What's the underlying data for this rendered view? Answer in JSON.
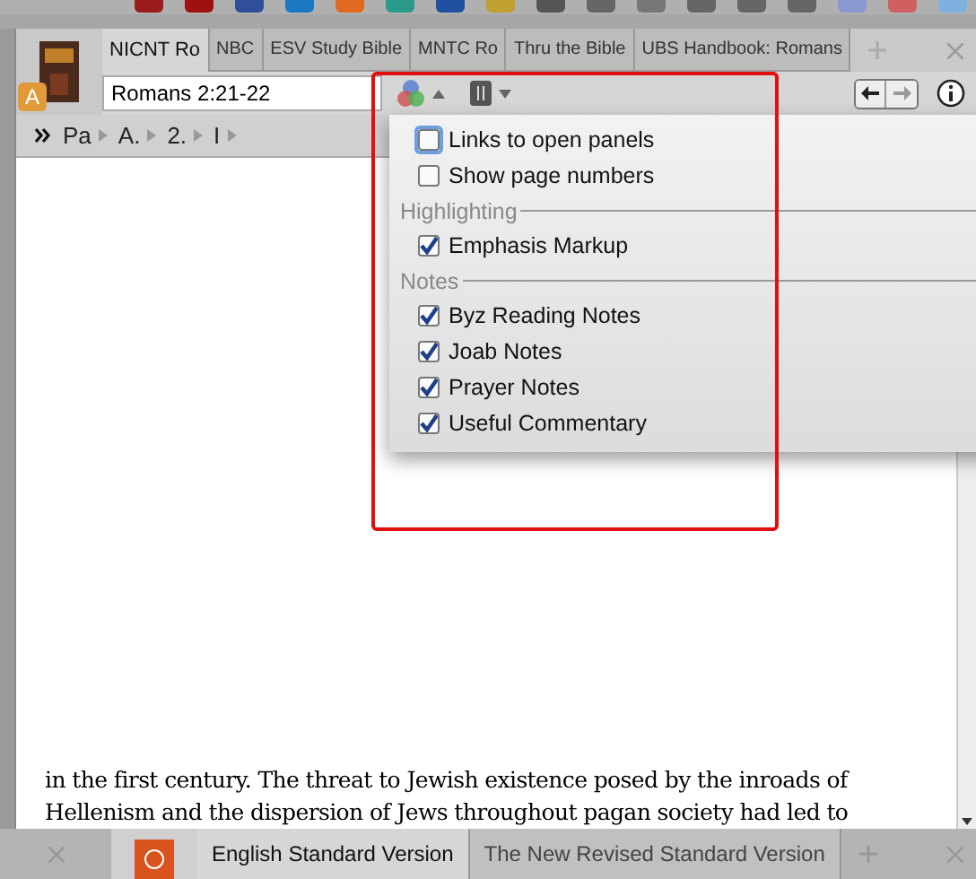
{
  "dock": [
    {
      "color": "#9b1c1c"
    },
    {
      "color": "#a01010"
    },
    {
      "color": "#2f4f9a"
    },
    {
      "color": "#1a78c2"
    },
    {
      "color": "#e06a20"
    },
    {
      "color": "#2a9a8a"
    },
    {
      "color": "#2050a0"
    },
    {
      "color": "#c0a030"
    },
    {
      "color": "#555555"
    },
    {
      "color": "#666666"
    },
    {
      "color": "#777777"
    },
    {
      "color": "#666666"
    },
    {
      "color": "#666666"
    },
    {
      "color": "#666666"
    },
    {
      "color": "#8a9ad0"
    },
    {
      "color": "#d06060"
    },
    {
      "color": "#80b0e0"
    }
  ],
  "panel": {
    "badge": "A",
    "tabs": [
      {
        "label": "NICNT Ro",
        "selected": true
      },
      {
        "label": "NBC",
        "selected": false
      },
      {
        "label": "ESV Study Bible",
        "selected": false
      },
      {
        "label": "MNTC Ro",
        "selected": false
      },
      {
        "label": "Thru the Bible",
        "selected": false
      },
      {
        "label": "UBS Handbook: Romans",
        "selected": false
      }
    ],
    "reference": "Romans 2:21-22",
    "breadcrumb": [
      "Pa",
      "A.",
      "2.",
      "I"
    ],
    "menu": {
      "items": [
        {
          "kind": "check",
          "label": "Links to open panels",
          "checked": false,
          "focused": true
        },
        {
          "kind": "check",
          "label": "Show page numbers",
          "checked": false,
          "focused": false
        },
        {
          "kind": "header",
          "label": "Highlighting"
        },
        {
          "kind": "check",
          "label": "Emphasis Markup",
          "checked": true,
          "focused": false
        },
        {
          "kind": "header",
          "label": "Notes"
        },
        {
          "kind": "check",
          "label": "Byz Reading Notes",
          "checked": true,
          "focused": false
        },
        {
          "kind": "check",
          "label": "Joab Notes",
          "checked": true,
          "focused": false
        },
        {
          "kind": "check",
          "label": "Prayer Notes",
          "checked": true,
          "focused": false
        },
        {
          "kind": "check",
          "label": "Useful Commentary",
          "checked": true,
          "focused": false
        }
      ]
    },
    "text": [
      "in the first century. The threat to Jewish existence posed by the inroads of",
      "Hellenism and the dispersion of Jews throughout pagan society had led to"
    ]
  },
  "bottom_tabs": [
    {
      "label": "English Standard Version",
      "selected": true
    },
    {
      "label": "The New Revised Standard Version",
      "selected": false
    }
  ]
}
